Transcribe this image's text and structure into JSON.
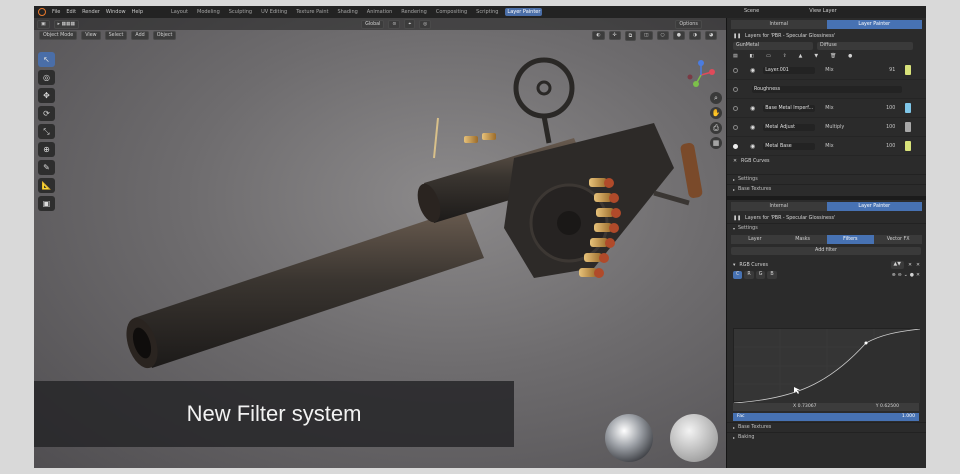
{
  "menu": [
    "File",
    "Edit",
    "Render",
    "Window",
    "Help"
  ],
  "workspaces": [
    {
      "label": "Layout",
      "active": false
    },
    {
      "label": "Modeling",
      "active": false
    },
    {
      "label": "Sculpting",
      "active": false
    },
    {
      "label": "UV Editing",
      "active": false
    },
    {
      "label": "Texture Paint",
      "active": false
    },
    {
      "label": "Shading",
      "active": false
    },
    {
      "label": "Animation",
      "active": false
    },
    {
      "label": "Rendering",
      "active": false
    },
    {
      "label": "Compositing",
      "active": false
    },
    {
      "label": "Scripting",
      "active": false
    },
    {
      "label": "Layer Painter",
      "active": true
    }
  ],
  "scene": {
    "scene_label": "Scene",
    "view_layer_label": "View Layer"
  },
  "viewport": {
    "transform_orientation": "Global",
    "options_label": "Options",
    "mode": "Object Mode",
    "menu": [
      "View",
      "Select",
      "Add",
      "Object"
    ],
    "caption": "New Filter system"
  },
  "panel_top": {
    "tabs": [
      {
        "label": "Internal",
        "active": false
      },
      {
        "label": "Layer Painter",
        "active": true
      }
    ],
    "layers_for": "Layers for 'PBR - Specular Glossiness'",
    "material": "GunMetal",
    "channel": "Diffuse",
    "layers": [
      {
        "name": "Layer.001",
        "blend": "Mix",
        "opacity": "91",
        "color": "#d8e27a",
        "selected": false
      },
      {
        "name": "Roughness",
        "blend": "",
        "opacity": "",
        "color": "#2b2b2b",
        "selected": false
      },
      {
        "name": "Base Metal Imperf...",
        "blend": "Mix",
        "opacity": "100",
        "color": "#7fc6e8",
        "selected": false
      },
      {
        "name": "Metal Adjust",
        "blend": "Multiply",
        "opacity": "100",
        "color": "#a8a8a8",
        "selected": false
      },
      {
        "name": "Metal Base",
        "blend": "Mix",
        "opacity": "100",
        "color": "#d8e27a",
        "selected": true
      }
    ],
    "curve_label": "RGB Curves",
    "sections": [
      "Settings",
      "Base Textures"
    ]
  },
  "panel_bottom": {
    "tabs": [
      {
        "label": "Internal",
        "active": false
      },
      {
        "label": "Layer Painter",
        "active": true
      }
    ],
    "layers_for": "Layers for 'PBR - Specular Glossiness'",
    "settings_label": "Settings",
    "sub_tabs": [
      {
        "label": "Layer",
        "active": false
      },
      {
        "label": "Masks",
        "active": false
      },
      {
        "label": "Filters",
        "active": true
      },
      {
        "label": "Vector FX",
        "active": false
      }
    ],
    "add_filter": "Add filter",
    "filter_name": "RGB Curves",
    "channel_buttons": [
      "C",
      "R",
      "G",
      "B"
    ],
    "readout_x": "X 0.73067",
    "readout_y": "Y 0.62500",
    "mix_label": "Fac",
    "mix_value": "1.000",
    "sections": [
      "Base Textures",
      "Baking"
    ]
  }
}
